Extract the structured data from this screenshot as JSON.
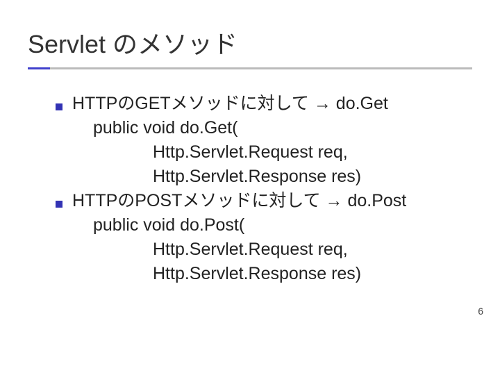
{
  "title": "Servlet のメソッド",
  "bullets": [
    {
      "heading": "HTTPのGETメソッドに対して → do.Get",
      "sub": [
        "public void do.Get(",
        "Http.Servlet.Request req,",
        "Http.Servlet.Response res)"
      ]
    },
    {
      "heading": "HTTPのPOSTメソッドに対して → do.Post",
      "sub": [
        "public void do.Post(",
        "Http.Servlet.Request req,",
        "Http.Servlet.Response res)"
      ]
    }
  ],
  "page_number": "6"
}
